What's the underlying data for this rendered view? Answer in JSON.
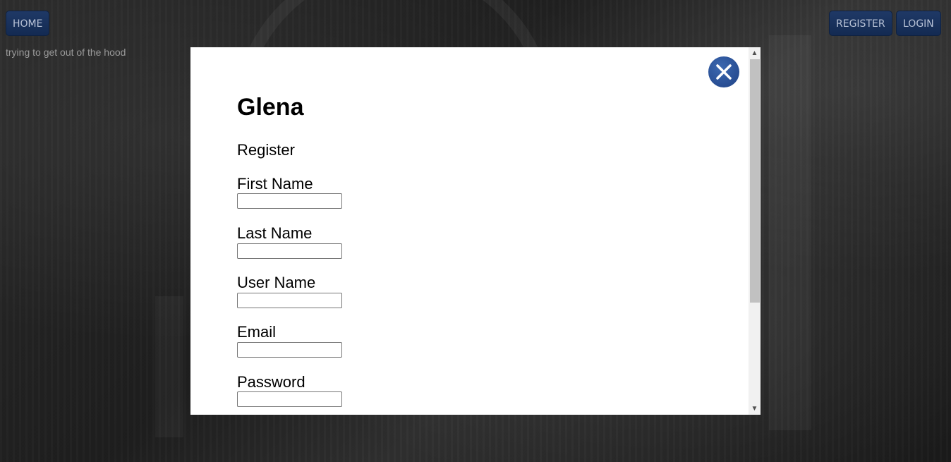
{
  "nav": {
    "home_label": "HOME",
    "register_label": "REGISTER",
    "login_label": "LOGIN"
  },
  "tagline": "trying to get out of the hood",
  "modal": {
    "title": "Glena",
    "subtitle": "Register",
    "close_icon": "close-icon",
    "fields": [
      {
        "label": "First Name",
        "value": "",
        "placeholder": ""
      },
      {
        "label": "Last Name",
        "value": "",
        "placeholder": ""
      },
      {
        "label": "User Name",
        "value": "",
        "placeholder": ""
      },
      {
        "label": "Email",
        "value": "",
        "placeholder": ""
      },
      {
        "label": "Password",
        "value": "",
        "placeholder": ""
      }
    ]
  },
  "colors": {
    "nav_button": "#1f3966",
    "close_button": "#2b56a0"
  }
}
